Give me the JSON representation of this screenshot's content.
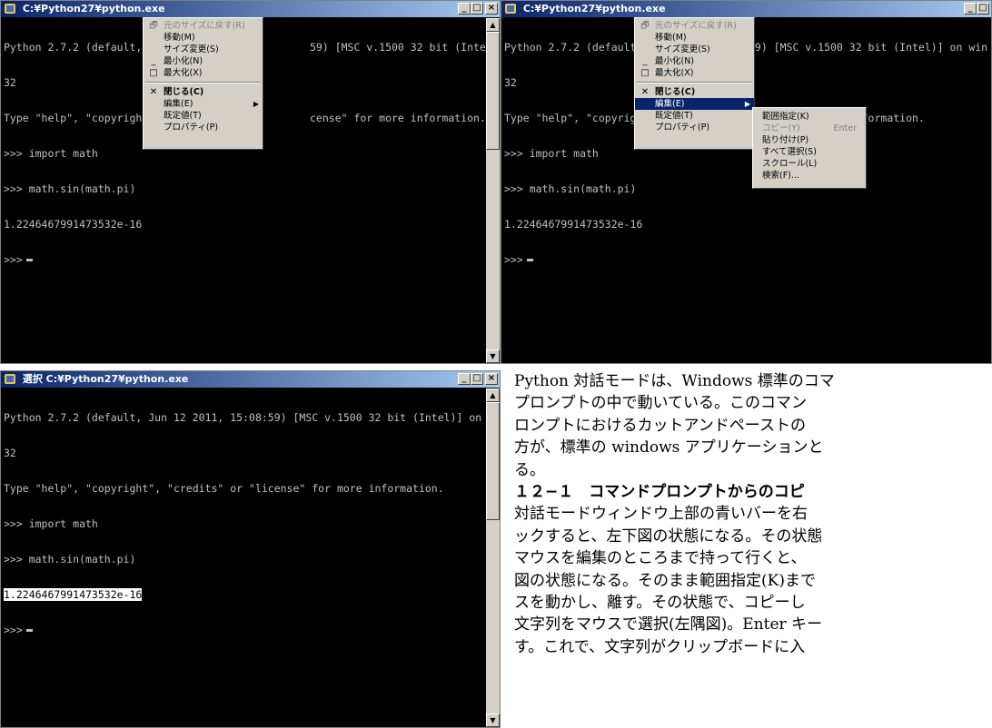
{
  "window_title": "C:¥Python27¥python.exe",
  "window_title_select": "選択 C:¥Python27¥python.exe",
  "window_buttons": {
    "minimize": "_",
    "maximize": "□",
    "close": "×"
  },
  "console_lines": [
    "Python 2.7.2 (default, Jun 12 2011, 15:08:59) [MSC v.1500 32 bit (Intel)] on win",
    "32",
    "Type \"help\", \"copyright\", \"credits\" or \"license\" for more information.",
    ">>> import math",
    ">>> math.sin(math.pi)",
    "1.2246467991473532e-16",
    ">>>"
  ],
  "console_lines_partial": [
    "Python 2.7.2 (default,",
    "32",
    "Type \"help\", \"copyrigh",
    ">>> import math",
    ">>> math.sin(math.pi)",
    "1.2246467991473532e-16",
    ">>>"
  ],
  "console_lines_partial_right": [
    "59) [MSC v.1500 32 bit (Intel)] on win",
    "",
    "cense\" for more information."
  ],
  "system_menu": {
    "restore": "元のサイズに戻す(R)",
    "move": "移動(M)",
    "size": "サイズ変更(S)",
    "minimize": "最小化(N)",
    "maximize": "最大化(X)",
    "close": "閉じる(C)",
    "edit": "編集(E)",
    "defaults": "既定値(T)",
    "properties": "プロパティ(P)"
  },
  "system_menu_icons": {
    "restore": "restore-icon",
    "minimize": "minimize-icon",
    "maximize": "maximize-icon",
    "close": "close-icon",
    "submenu": "submenu-arrow-icon"
  },
  "edit_submenu": {
    "mark": "範囲指定(K)",
    "copy": "コピー(Y)",
    "copy_shortcut": "Enter",
    "paste": "貼り付け(P)",
    "select_all": "すべて選択(S)",
    "scroll": "スクロール(L)",
    "find": "検索(F)..."
  },
  "doc_text": [
    "Python 対話モードは、Windows 標準のコマ",
    "プロンプトの中で動いている。このコマン",
    "ロンプトにおけるカットアンドペーストの",
    "方が、標準の windows アプリケーションと",
    "る。",
    "１２−１　コマンドプロンプトからのコピ",
    "対話モードウィンドウ上部の青いバーを右",
    "ックすると、左下図の状態になる。その状態",
    "マウスを編集のところまで持って行くと、",
    "図の状態になる。そのまま範囲指定(K)まで",
    "スを動かし、離す。その状態で、コピーし",
    "文字列をマウスで選択(左隅図)。Enter キー",
    "す。これで、文字列がクリップボードに入"
  ],
  "colors": {
    "title_start": "#0a246a",
    "title_end": "#a6caf0",
    "console_bg": "#000000",
    "console_text": "#c0c0c0",
    "menu_bg": "#d4d0c8",
    "menu_highlight": "#0a246a"
  }
}
